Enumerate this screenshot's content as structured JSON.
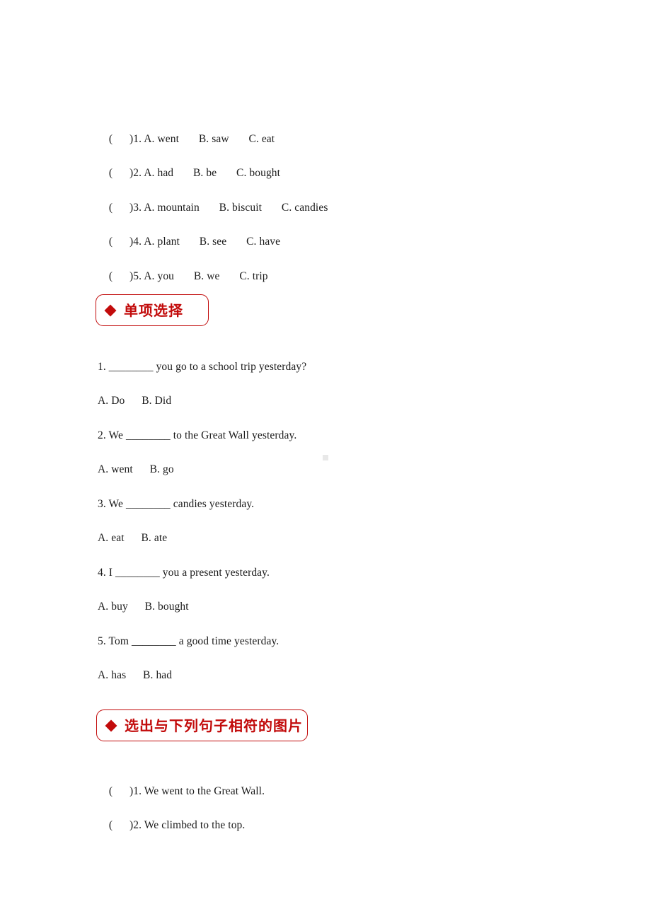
{
  "page": {
    "background_color": "#ffffff",
    "text_color": "#1a1a1a",
    "accent_color": "#c20b0b"
  },
  "odd_one_out": {
    "items": [
      {
        "bracket": "(      )",
        "text": "1. A. went       B. saw       C. eat"
      },
      {
        "bracket": "(      )",
        "text": "2. A. had       B. be       C. bought"
      },
      {
        "bracket": "(      )",
        "text": "3. A. mountain       B. biscuit       C. candies"
      },
      {
        "bracket": "(      )",
        "text": "4. A. plant       B. see       C. have"
      },
      {
        "bracket": "(      )",
        "text": "5. A. you       B. we       C. trip"
      }
    ]
  },
  "section_one": {
    "bullet": "diamond-bullet",
    "title": "单项选择"
  },
  "multiple_choice": {
    "questions": [
      {
        "stem": "1. ________ you go to a school trip yesterday?",
        "options": "A. Do      B. Did"
      },
      {
        "stem": "2. We ________ to the Great Wall yesterday.",
        "options": "A. went      B. go"
      },
      {
        "stem": "3. We ________ candies yesterday.",
        "options": "A. eat      B. ate"
      },
      {
        "stem": "4. I ________ you a present yesterday.",
        "options": "A. buy      B. bought"
      },
      {
        "stem": "5. Tom ________ a good time yesterday.",
        "options": "A. has      B. had"
      }
    ]
  },
  "section_two": {
    "bullet": "diamond-bullet",
    "title": "选出与下列句子相符的图片"
  },
  "picture_match": {
    "items": [
      {
        "bracket": "(      )",
        "text": "1. We went to the Great Wall."
      },
      {
        "bracket": "(      )",
        "text": "2. We climbed to the top."
      }
    ]
  }
}
